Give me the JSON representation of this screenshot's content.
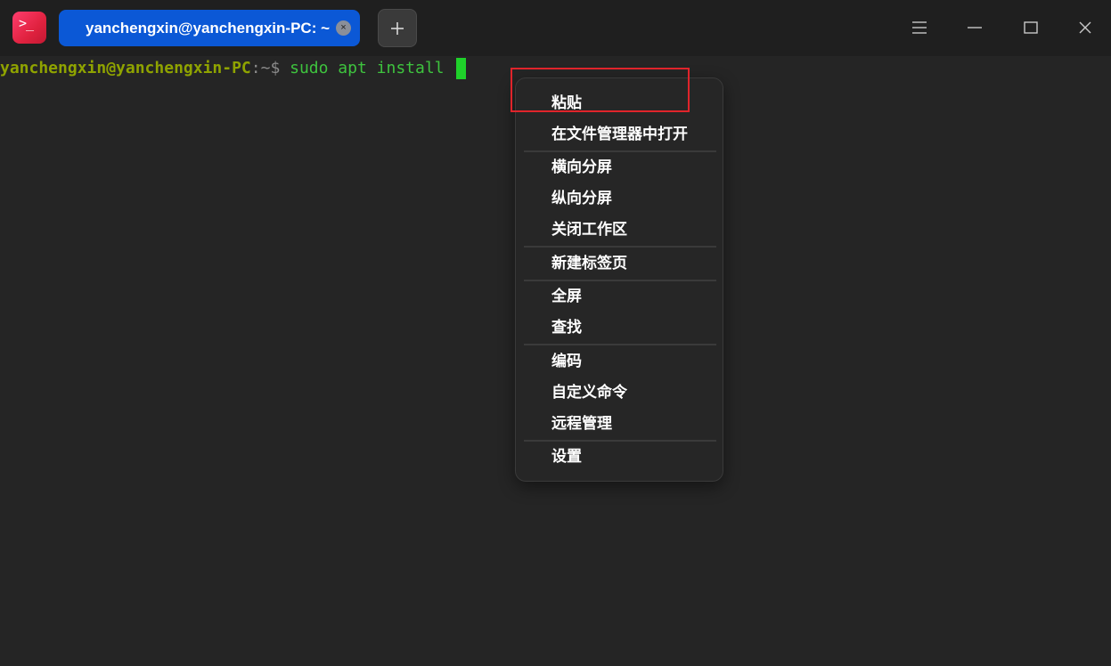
{
  "titlebar": {
    "tab_title": "yanchengxin@yanchengxin-PC: ~",
    "app_icon_glyph": ">_",
    "tab_close_glyph": "×",
    "icons": {
      "app": "terminal-app-icon",
      "new_tab": "plus-icon",
      "menu": "hamburger-menu-icon",
      "minimize": "minimize-icon",
      "maximize": "maximize-icon",
      "close": "close-icon"
    }
  },
  "terminal": {
    "prompt_user": "yanchengxin@yanchengxin-PC",
    "prompt_sep": ":~$ ",
    "command": "sudo apt install "
  },
  "context_menu": {
    "items": [
      "粘贴",
      "在文件管理器中打开",
      "横向分屏",
      "纵向分屏",
      "关闭工作区",
      "新建标签页",
      "全屏",
      "查找",
      "编码",
      "自定义命令",
      "远程管理",
      "设置"
    ],
    "highlighted_item": "粘贴"
  },
  "colors": {
    "tab_active": "#0b58d6",
    "prompt_user": "#8fa300",
    "command": "#3ec33e",
    "cursor": "#1fd12a",
    "highlight_border": "#e0242b"
  }
}
